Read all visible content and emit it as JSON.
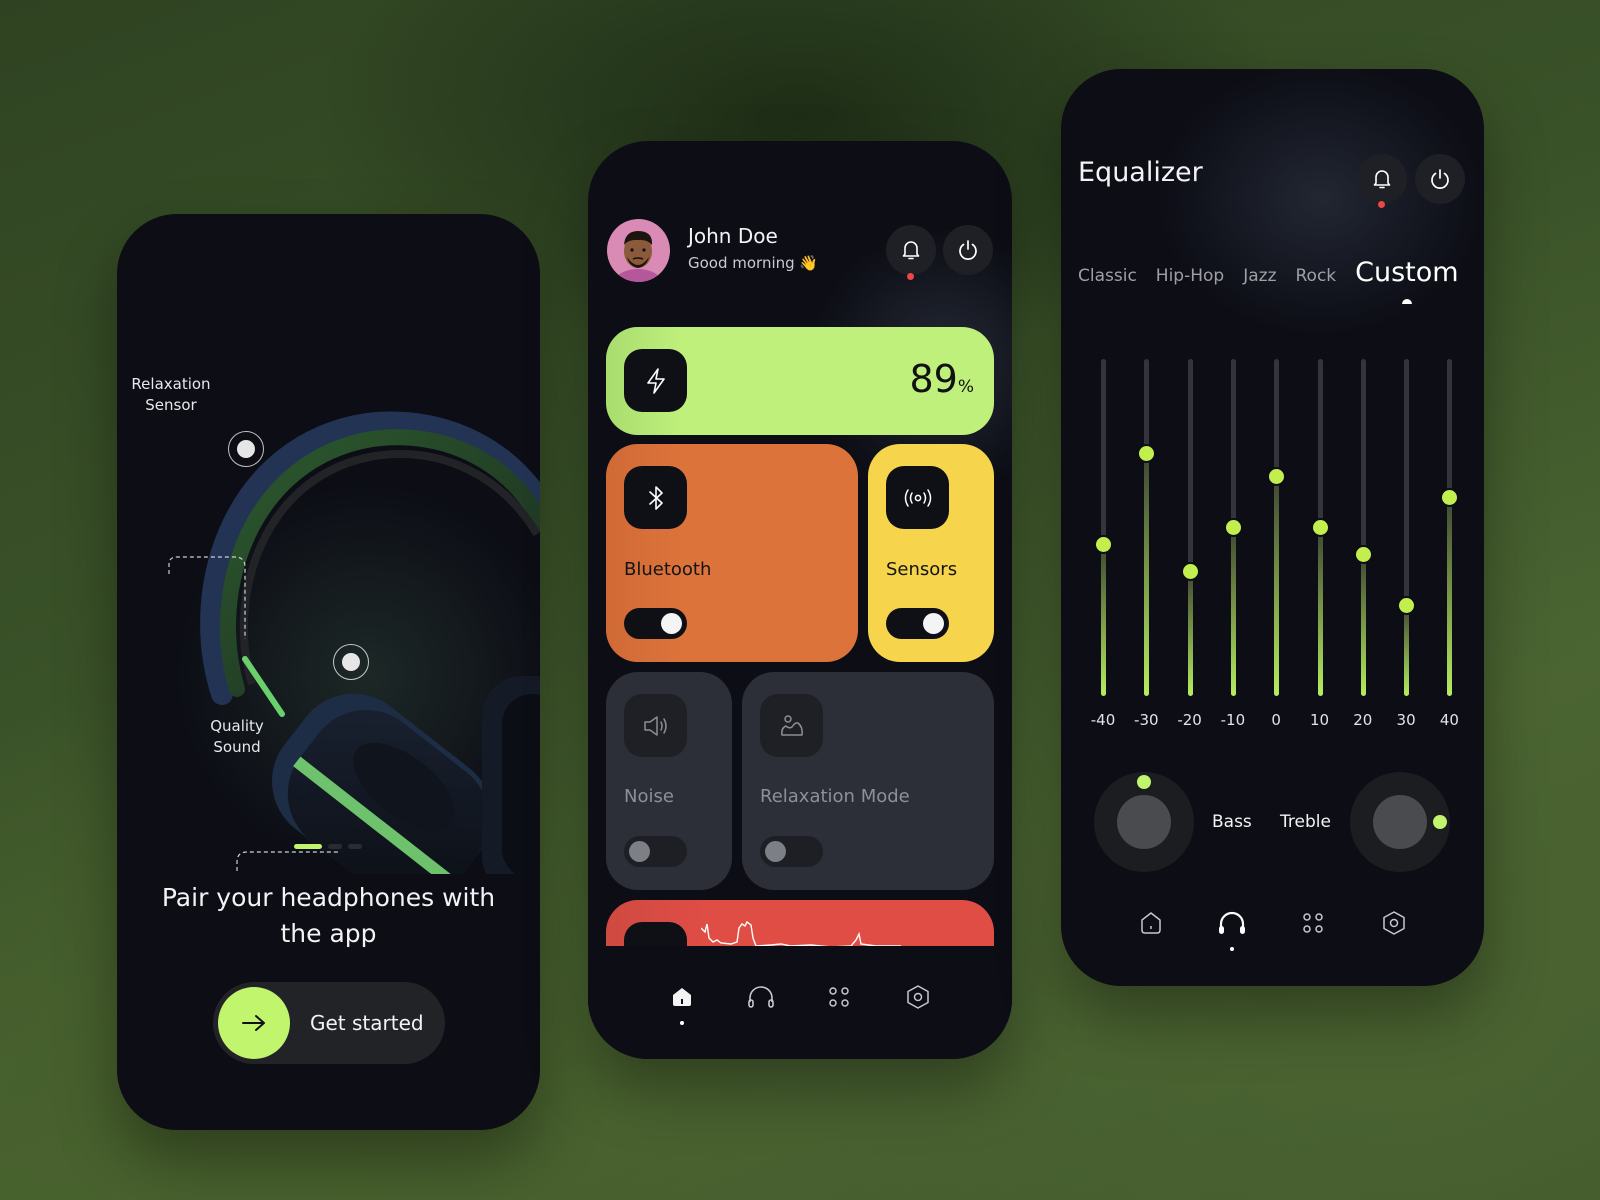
{
  "colors": {
    "accent_lime": "#c2f56e",
    "battery_tile": "#bff07c",
    "bluetooth_tile": "#dc733b",
    "sensors_tile": "#f6d44b",
    "inactive_tile": "#2c2f37",
    "music_tile": "#df4d45",
    "notification_dot": "#f04545",
    "phone_bg": "#0c0d15"
  },
  "onboarding": {
    "annotations": [
      {
        "label_line1": "Relaxation",
        "label_line2": "Sensor",
        "icon": "hotspot-icon"
      },
      {
        "label_line1": "Quality",
        "label_line2": "Sound",
        "icon": "hotspot-icon"
      }
    ],
    "pager": {
      "total": 3,
      "active_index": 0
    },
    "title": "Pair your headphones with the app",
    "cta": {
      "label": "Get started",
      "icon": "arrow-right-icon"
    }
  },
  "dashboard": {
    "user": {
      "name": "John Doe",
      "greeting": "Good morning 👋",
      "avatar_icon": "memoji-avatar"
    },
    "header_buttons": [
      {
        "name": "notifications",
        "icon": "bell-icon",
        "has_badge": true
      },
      {
        "name": "power",
        "icon": "power-icon"
      }
    ],
    "battery": {
      "icon": "lightning-icon",
      "value": "89",
      "unit": "%"
    },
    "tiles": [
      {
        "label": "Bluetooth",
        "icon": "bluetooth-icon",
        "on": true
      },
      {
        "label": "Sensors",
        "icon": "broadcast-icon",
        "on": true
      },
      {
        "label": "Noise",
        "icon": "speaker-icon",
        "on": false
      },
      {
        "label": "Relaxation Mode",
        "icon": "landscape-icon",
        "on": false
      }
    ],
    "now_playing": {
      "icon": "waveform-icon"
    },
    "nav": [
      {
        "name": "home",
        "icon": "home-icon",
        "active": true
      },
      {
        "name": "headphones",
        "icon": "headphones-icon",
        "active": false
      },
      {
        "name": "apps",
        "icon": "grid-dots-icon",
        "active": false
      },
      {
        "name": "settings",
        "icon": "hex-settings-icon",
        "active": false
      }
    ]
  },
  "equalizer": {
    "title": "Equalizer",
    "header_buttons": [
      {
        "name": "notifications",
        "icon": "bell-icon",
        "has_badge": true
      },
      {
        "name": "power",
        "icon": "power-icon"
      }
    ],
    "presets": [
      "Classic",
      "Hip-Hop",
      "Jazz",
      "Rock",
      "Custom"
    ],
    "active_preset": "Custom",
    "bands": [
      {
        "label": "-40",
        "level": 0.45
      },
      {
        "label": "-30",
        "level": 0.72
      },
      {
        "label": "-20",
        "level": 0.37
      },
      {
        "label": "-10",
        "level": 0.5
      },
      {
        "label": "0",
        "level": 0.65
      },
      {
        "label": "10",
        "level": 0.5
      },
      {
        "label": "20",
        "level": 0.42
      },
      {
        "label": "30",
        "level": 0.27
      },
      {
        "label": "40",
        "level": 0.59
      }
    ],
    "dials": [
      {
        "label": "Bass",
        "angle_deg": 0
      },
      {
        "label": "Treble",
        "angle_deg": 90
      }
    ],
    "nav": [
      {
        "name": "home",
        "icon": "home-icon",
        "active": false
      },
      {
        "name": "headphones",
        "icon": "headphones-icon",
        "active": true
      },
      {
        "name": "apps",
        "icon": "grid-dots-icon",
        "active": false
      },
      {
        "name": "settings",
        "icon": "hex-settings-icon",
        "active": false
      }
    ]
  }
}
